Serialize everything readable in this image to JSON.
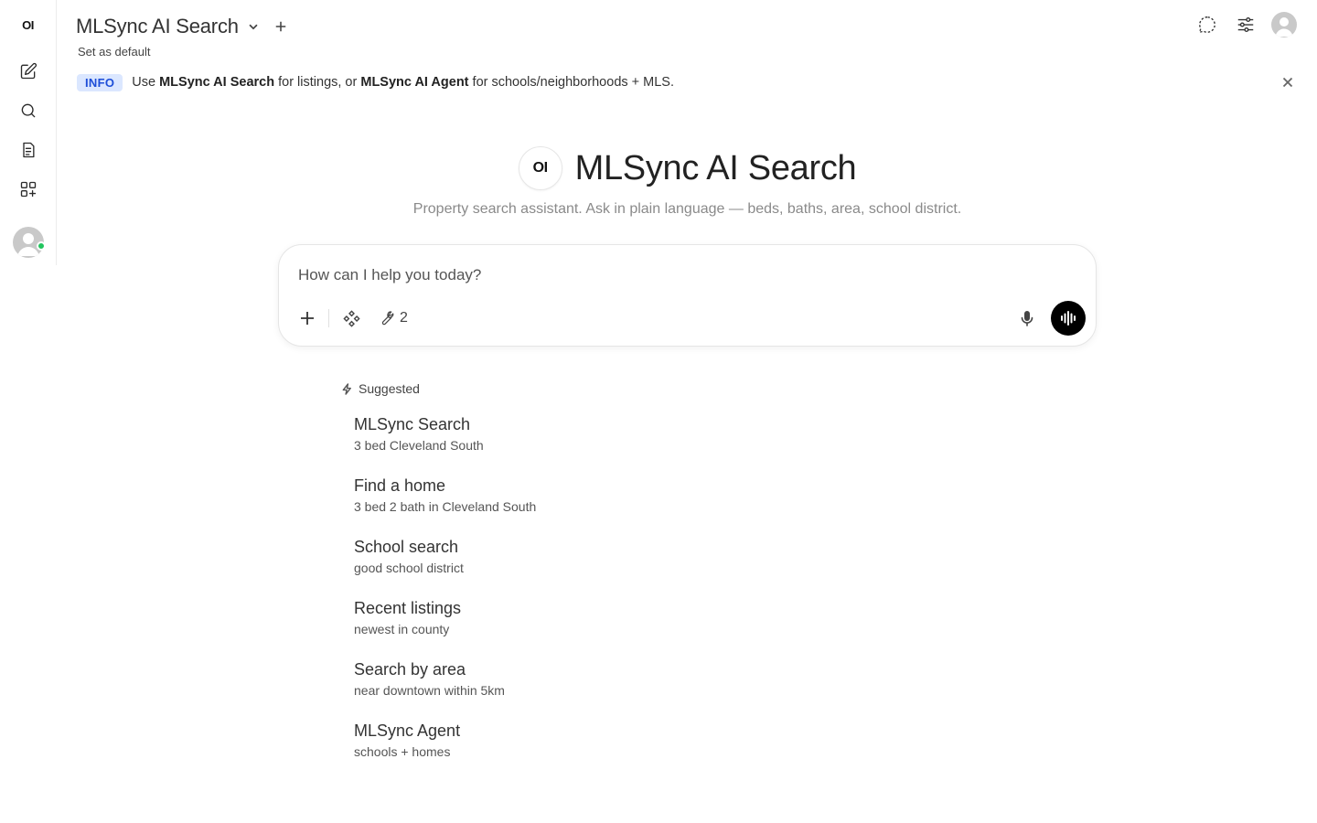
{
  "rail": {
    "logo": "OI"
  },
  "header": {
    "model_name": "MLSync AI Search",
    "set_default": "Set as default"
  },
  "banner": {
    "badge": "INFO",
    "pre": "Use ",
    "bold1": "MLSync AI Search",
    "mid": " for listings, or ",
    "bold2": "MLSync AI Agent",
    "post": " for schools/neighborhoods + MLS."
  },
  "hero": {
    "logo": "OI",
    "title": "MLSync AI Search",
    "subtitle": "Property search assistant. Ask in plain language — beds, baths, area, school district."
  },
  "composer": {
    "placeholder": "How can I help you today?",
    "tools_count": "2"
  },
  "suggested": {
    "heading": "Suggested",
    "items": [
      {
        "title": "MLSync Search",
        "desc": "3 bed Cleveland South"
      },
      {
        "title": "Find a home",
        "desc": "3 bed 2 bath in Cleveland South"
      },
      {
        "title": "School search",
        "desc": "good school district"
      },
      {
        "title": "Recent listings",
        "desc": "newest in county"
      },
      {
        "title": "Search by area",
        "desc": "near downtown within 5km"
      },
      {
        "title": "MLSync Agent",
        "desc": "schools + homes"
      }
    ]
  },
  "colors": {
    "accent_badge_bg": "#dbe7ff",
    "accent_badge_text": "#1d4ed8",
    "online": "#22c55e",
    "voice_button": "#000000"
  }
}
